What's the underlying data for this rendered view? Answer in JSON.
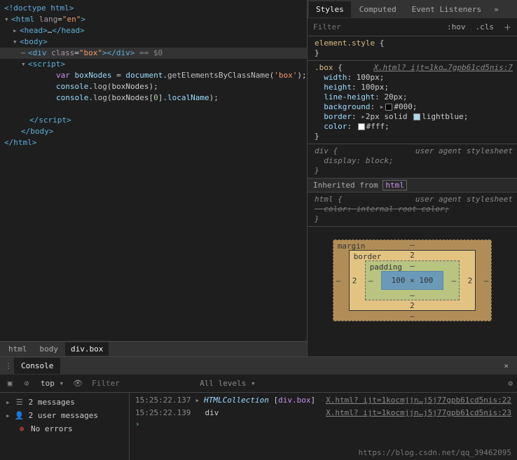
{
  "dom": {
    "l0": "<!doctype html>",
    "l1_open": "<html ",
    "l1_attr": "lang",
    "l1_val": "\"en\"",
    "l1_close": ">",
    "l2": "<head>",
    "l2_ell": "…",
    "l2_end": "</head>",
    "l3": "<body>",
    "l4_open": "<div ",
    "l4_attr": "class",
    "l4_val": "\"box\"",
    "l4_mid": "></div>",
    "l4_eq": " == $0",
    "l5": "<script>",
    "l6_kw": "var ",
    "l6_id": "boxNodes",
    "l6_eq": " = ",
    "l6_obj": "document",
    "l6_dot": ".",
    "l6_fn": "getElementsByClassName",
    "l6_p1": "(",
    "l6_str": "'box'",
    "l6_p2": ");",
    "l7_obj": "console",
    "l7_dot": ".",
    "l7_fn": "log",
    "l7_p": "(boxNodes);",
    "l8_obj": "console",
    "l8_dot": ".",
    "l8_fn": "log",
    "l8_p1": "(boxNodes[",
    "l8_n": "0",
    "l8_p2": "].",
    "l8_id": "localName",
    "l8_p3": ");",
    "l9": "</script>",
    "l10": "</body>",
    "l11": "</html>"
  },
  "crumbs": [
    "html",
    "body",
    "div.box"
  ],
  "tabs": {
    "styles": "Styles",
    "computed": "Computed",
    "events": "Event Listeners"
  },
  "filter": {
    "placeholder": "Filter",
    "hov": ":hov",
    "cls": ".cls"
  },
  "rules": {
    "elem_sel": "element.style",
    "brace_o": " {",
    "brace_c": "}",
    "box_sel": ".box",
    "box_link": "X.html? ijt=1ko…7gpb61cd5nis:7",
    "width_p": "width",
    "width_v": "100px",
    "height_p": "height",
    "height_v": "100px",
    "lh_p": "line-height",
    "lh_v": "20px",
    "bg_p": "background",
    "bg_v": "#000",
    "bd_p": "border",
    "bd_v1": "2px solid ",
    "bd_v2": "lightblue",
    "col_p": "color",
    "col_v": "#fff",
    "div_sel": "div",
    "ua": "user agent stylesheet",
    "disp_p": "display",
    "disp_v": "block",
    "inherit": "Inherited from ",
    "inherit_tag": "html",
    "html_sel": "html",
    "rc_p": "color",
    "rc_v": "internal root color"
  },
  "box_model": {
    "margin": "margin",
    "margin_v": "–",
    "border": "border",
    "border_v": "2",
    "padding": "padding",
    "padding_v": "–",
    "content": "100 × 100"
  },
  "console": {
    "tab": "Console",
    "top": "top",
    "filter_ph": "Filter",
    "levels": "All levels",
    "side": {
      "messages": "2 messages",
      "user": "2 user messages",
      "errors": "No errors"
    },
    "log1": {
      "ts": "15:25:22.137",
      "obj": "HTMLCollection ",
      "bracket": "[",
      "tag": "div.box",
      "bracket2": "]",
      "link": "X.html? ijt=1kocmjjn…j5j77gpb61cd5nis:22"
    },
    "log2": {
      "ts": "15:25:22.139",
      "txt": "div",
      "link": "X.html? ijt=1kocmjjn…j5j77gpb61cd5nis:23"
    },
    "watermark": "https://blog.csdn.net/qq_39462095"
  }
}
